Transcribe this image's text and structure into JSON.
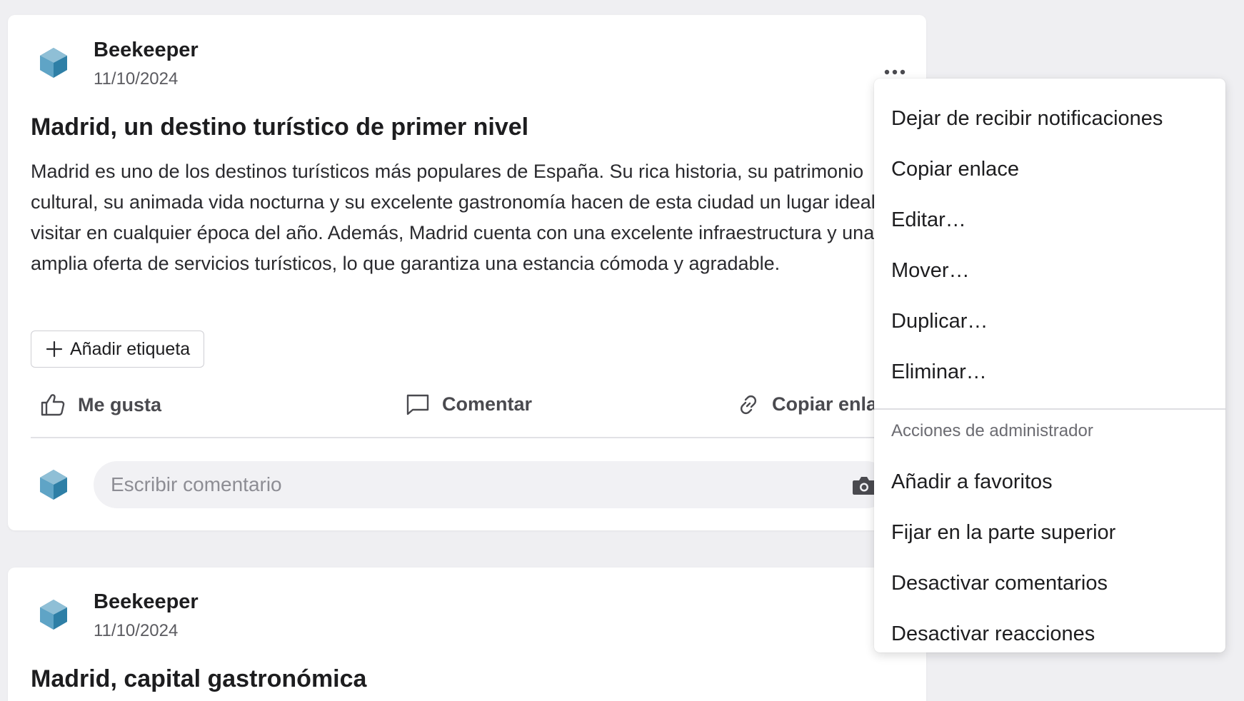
{
  "posts": [
    {
      "author": "Beekeeper",
      "date": "11/10/2024",
      "title": "Madrid, un destino turístico de primer nivel",
      "body": "Madrid es uno de los destinos turísticos más populares de España. Su rica historia, su patrimonio cultural, su animada vida nocturna y su excelente gastronomía hacen de esta ciudad un lugar ideal para visitar en cualquier época del año. Además, Madrid cuenta con una excelente infraestructura y una amplia oferta de servicios turísticos, lo que garantiza una estancia cómoda y agradable.",
      "add_tag_label": "Añadir etiqueta",
      "actions": {
        "like": "Me gusta",
        "comment": "Comentar",
        "copy_link": "Copiar enlace"
      },
      "comment_placeholder": "Escribir comentario"
    },
    {
      "author": "Beekeeper",
      "date": "11/10/2024",
      "title": "Madrid, capital gastronómica"
    }
  ],
  "menu": {
    "items": [
      "Dejar de recibir notificaciones",
      "Copiar enlace",
      "Editar…",
      "Mover…",
      "Duplicar…",
      "Eliminar…"
    ],
    "admin_header": "Acciones de administrador",
    "admin_items": [
      "Añadir a favoritos",
      "Fijar en la parte superior",
      "Desactivar comentarios",
      "Desactivar reacciones"
    ]
  },
  "colors": {
    "background": "#efeff2",
    "card": "#ffffff",
    "avatar_dark": "#2e7fa6",
    "avatar_light": "#8fbfd6"
  },
  "icons": {
    "more": "more-horizontal-icon",
    "add": "plus-icon",
    "like": "thumbs-up-icon",
    "comment": "speech-bubble-icon",
    "copy_link": "link-icon",
    "camera": "camera-icon",
    "avatar": "hexagon-logo-icon"
  }
}
